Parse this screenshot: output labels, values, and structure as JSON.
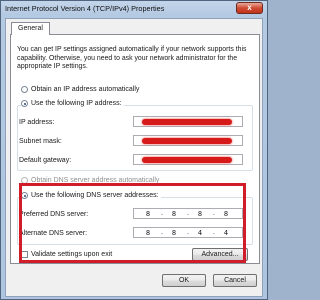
{
  "window": {
    "title": "Internet Protocol Version 4 (TCP/IPv4) Properties",
    "close_glyph": "x"
  },
  "tabs": [
    {
      "label": "General"
    }
  ],
  "intro_text": "You can get IP settings assigned automatically if your network supports this capability. Otherwise, you need to ask your network administrator for the appropriate IP settings.",
  "ip_section": {
    "auto_label": "Obtain an IP address automatically",
    "manual_label": "Use the following IP address:",
    "ip_address_label": "IP address:",
    "subnet_mask_label": "Subnet mask:",
    "default_gateway_label": "Default gateway:"
  },
  "dns_section": {
    "auto_label": "Obtain DNS server address automatically",
    "manual_label": "Use the following DNS server addresses:",
    "preferred_label": "Preferred DNS server:",
    "alternate_label": "Alternate DNS server:",
    "preferred": [
      "8",
      "8",
      "8",
      "8"
    ],
    "alternate": [
      "8",
      "8",
      "4",
      "4"
    ]
  },
  "validate_label": "Validate settings upon exit",
  "buttons": {
    "advanced": "Advanced...",
    "ok": "OK",
    "cancel": "Cancel"
  },
  "colors": {
    "highlight_border": "#d11d2a",
    "redaction": "#d61a1a"
  }
}
